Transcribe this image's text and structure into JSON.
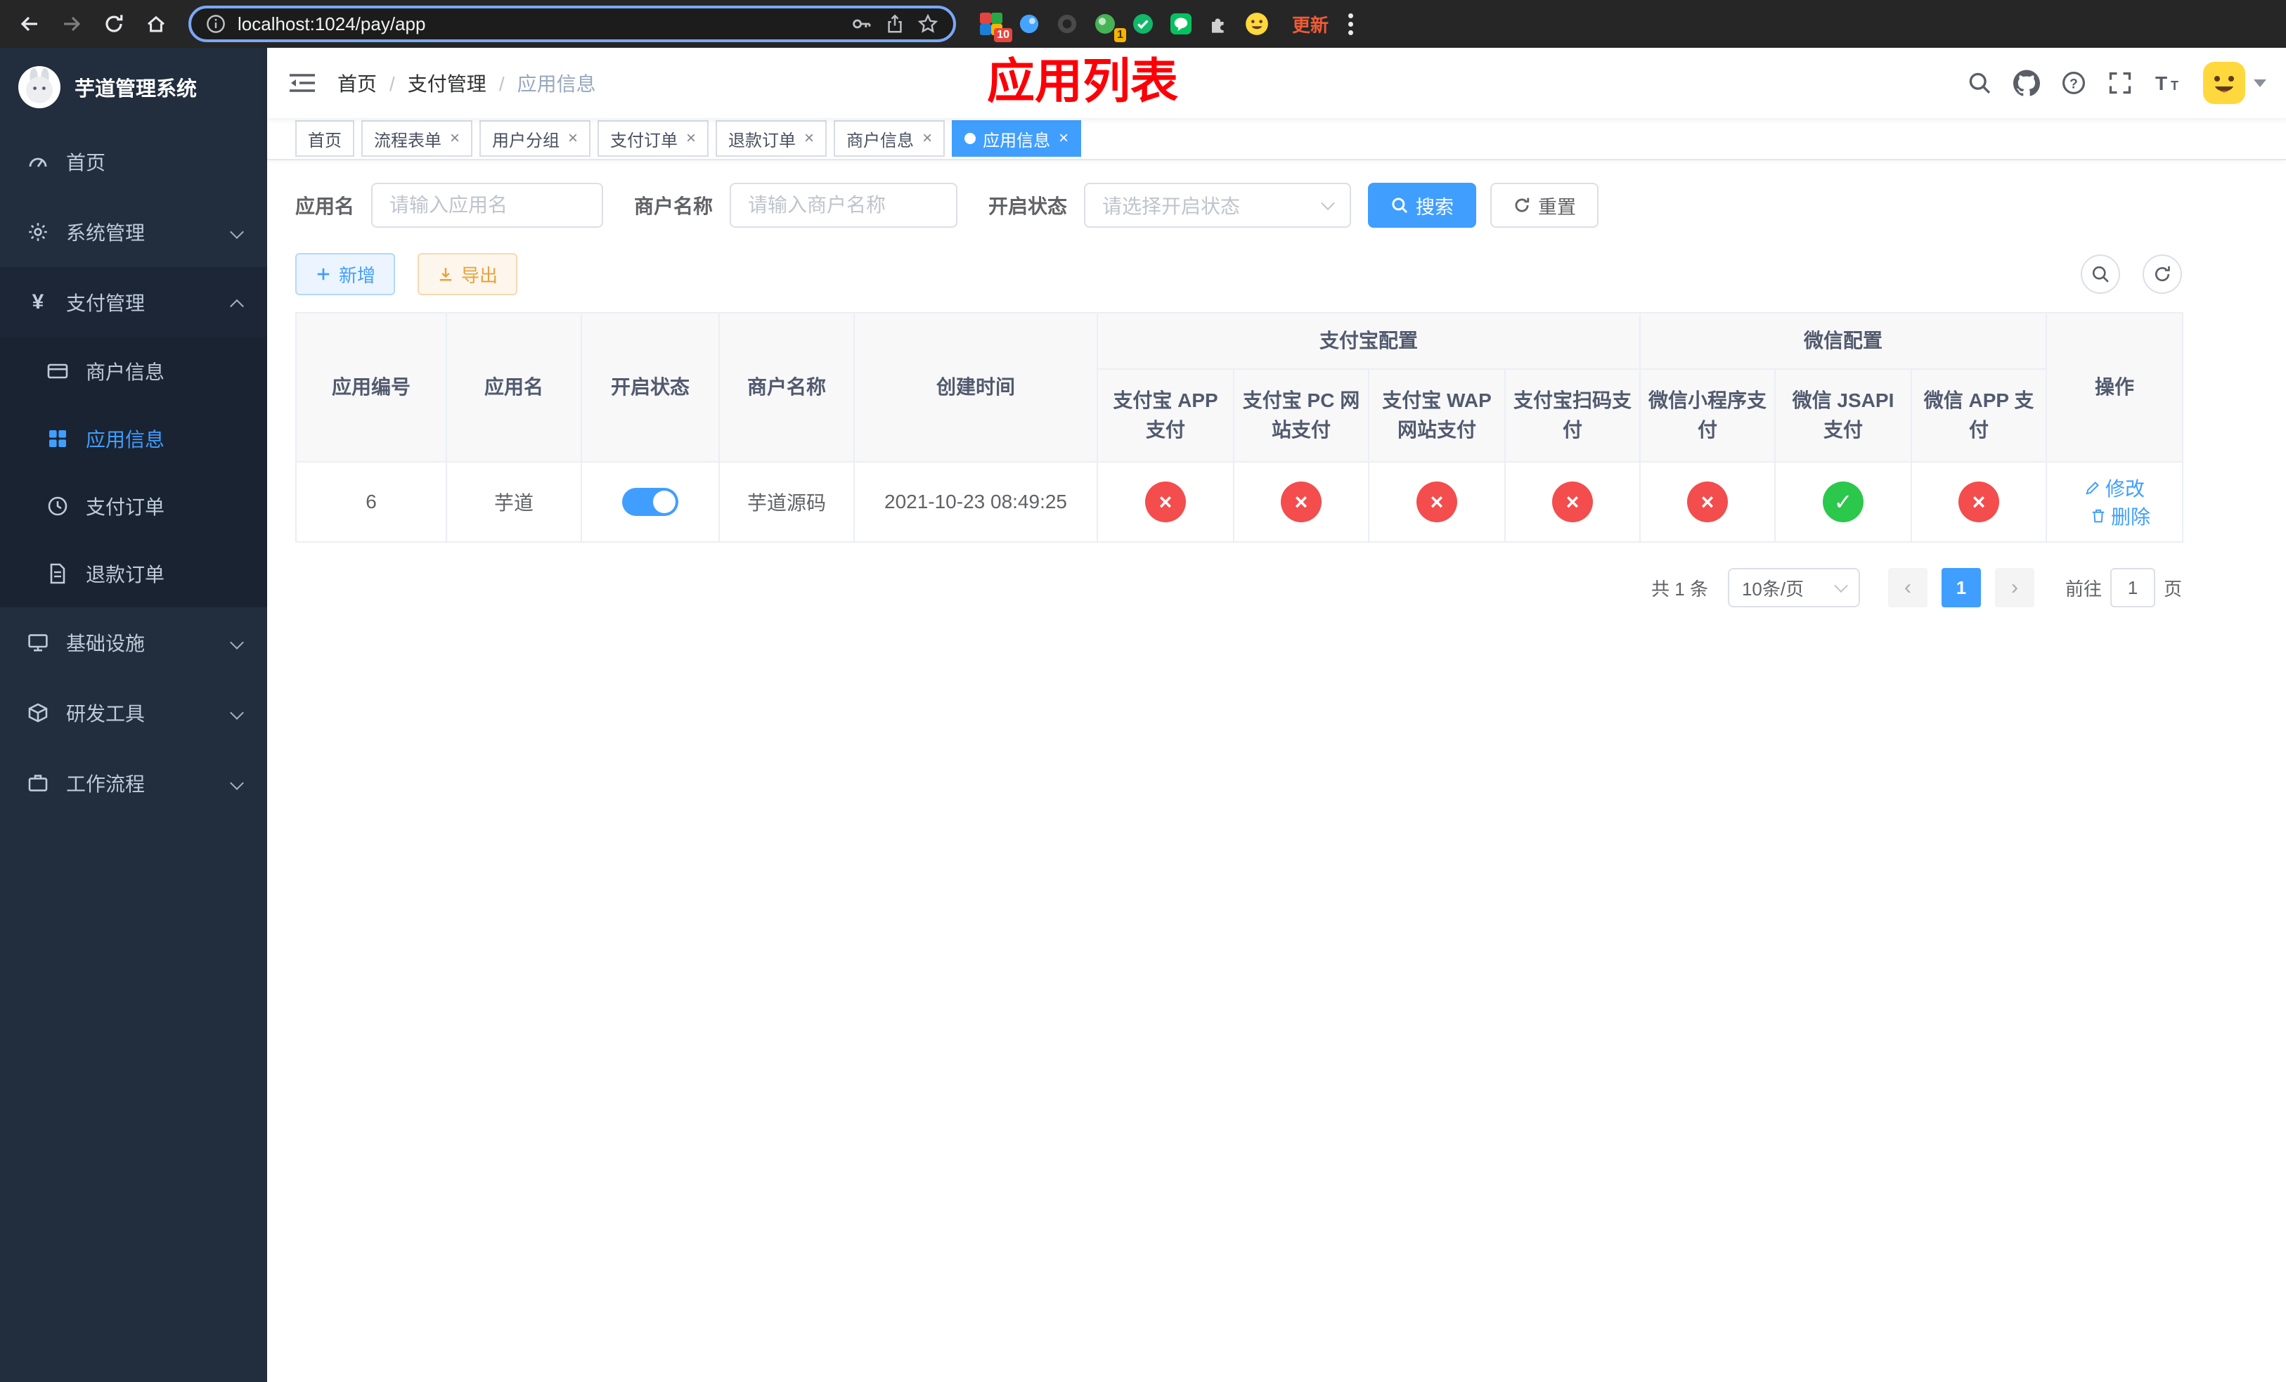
{
  "browser": {
    "url": "localhost:1024/pay/app",
    "update_label": "更新",
    "ext_badge_a": "10",
    "ext_badge_b": "1"
  },
  "sidebar": {
    "title": "芋道管理系统",
    "items": [
      {
        "label": "首页"
      },
      {
        "label": "系统管理"
      },
      {
        "label": "支付管理"
      },
      {
        "label": "基础设施"
      },
      {
        "label": "研发工具"
      },
      {
        "label": "工作流程"
      }
    ],
    "payment_children": [
      {
        "label": "商户信息"
      },
      {
        "label": "应用信息"
      },
      {
        "label": "支付订单"
      },
      {
        "label": "退款订单"
      }
    ]
  },
  "navbar": {
    "breadcrumb": [
      "首页",
      "支付管理",
      "应用信息"
    ],
    "overlay_title": "应用列表"
  },
  "tabs": [
    {
      "label": "首页"
    },
    {
      "label": "流程表单"
    },
    {
      "label": "用户分组"
    },
    {
      "label": "支付订单"
    },
    {
      "label": "退款订单"
    },
    {
      "label": "商户信息"
    },
    {
      "label": "应用信息"
    }
  ],
  "filters": {
    "app_name_label": "应用名",
    "app_name_placeholder": "请输入应用名",
    "merchant_label": "商户名称",
    "merchant_placeholder": "请输入商户名称",
    "status_label": "开启状态",
    "status_placeholder": "请选择开启状态",
    "search_label": "搜索",
    "reset_label": "重置"
  },
  "toolbar": {
    "add_label": "新增",
    "export_label": "导出"
  },
  "table": {
    "headers": {
      "app_id": "应用编号",
      "app_name": "应用名",
      "status": "开启状态",
      "merchant": "商户名称",
      "created": "创建时间",
      "alipay_group": "支付宝配置",
      "wechat_group": "微信配置",
      "alipay_app": "支付宝 APP 支付",
      "alipay_pc": "支付宝 PC 网站支付",
      "alipay_wap": "支付宝 WAP 网站支付",
      "alipay_qr": "支付宝扫码支付",
      "wx_mini": "微信小程序支付",
      "wx_jsapi": "微信 JSAPI 支付",
      "wx_app": "微信 APP 支付",
      "ops": "操作"
    },
    "row": {
      "id": "6",
      "name": "芋道",
      "merchant": "芋道源码",
      "created": "2021-10-23 08:49:25",
      "channels": [
        "cross",
        "cross",
        "cross",
        "cross",
        "cross",
        "check",
        "cross"
      ],
      "edit_label": "修改",
      "delete_label": "删除"
    }
  },
  "pagination": {
    "total": "共 1 条",
    "per_page": "10条/页",
    "page": "1",
    "goto_label": "前往",
    "goto_value": "1",
    "page_unit": "页"
  },
  "colors": {
    "primary": "#409eff",
    "danger": "#f34d4d",
    "success": "#2bc84c",
    "sidebar_bg": "#222d3d",
    "annotation_red": "#fb0007"
  }
}
